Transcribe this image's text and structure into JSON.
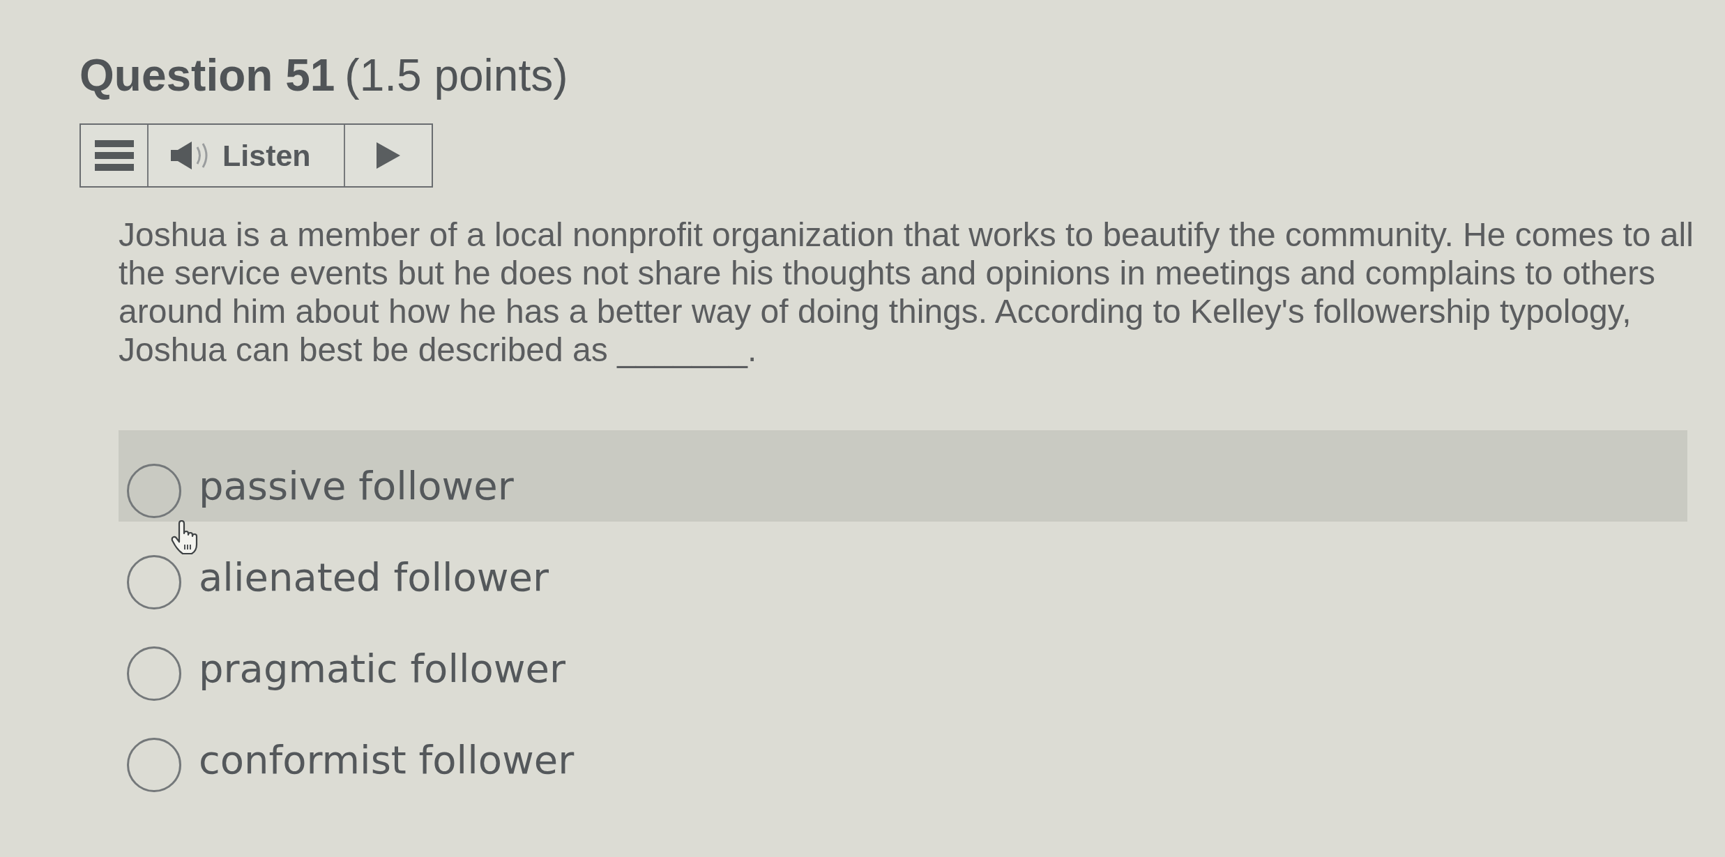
{
  "question": {
    "title": "Question 51",
    "points": "(1.5 points)"
  },
  "read_aloud": {
    "label": "Listen"
  },
  "prompt": "Joshua is a member of a local nonprofit organization that works to beautify the community. He comes to all the service events but he does not share his thoughts and opinions in meetings and complains to others around him about how he has a better way of doing things. According to Kelley's followership typology, Joshua can best be described as _______.",
  "options": [
    {
      "label": "passive follower",
      "selected": false,
      "hovered": true
    },
    {
      "label": "alienated follower",
      "selected": false,
      "hovered": false
    },
    {
      "label": "pragmatic follower",
      "selected": false,
      "hovered": false
    },
    {
      "label": "conformist follower",
      "selected": false,
      "hovered": false
    }
  ]
}
